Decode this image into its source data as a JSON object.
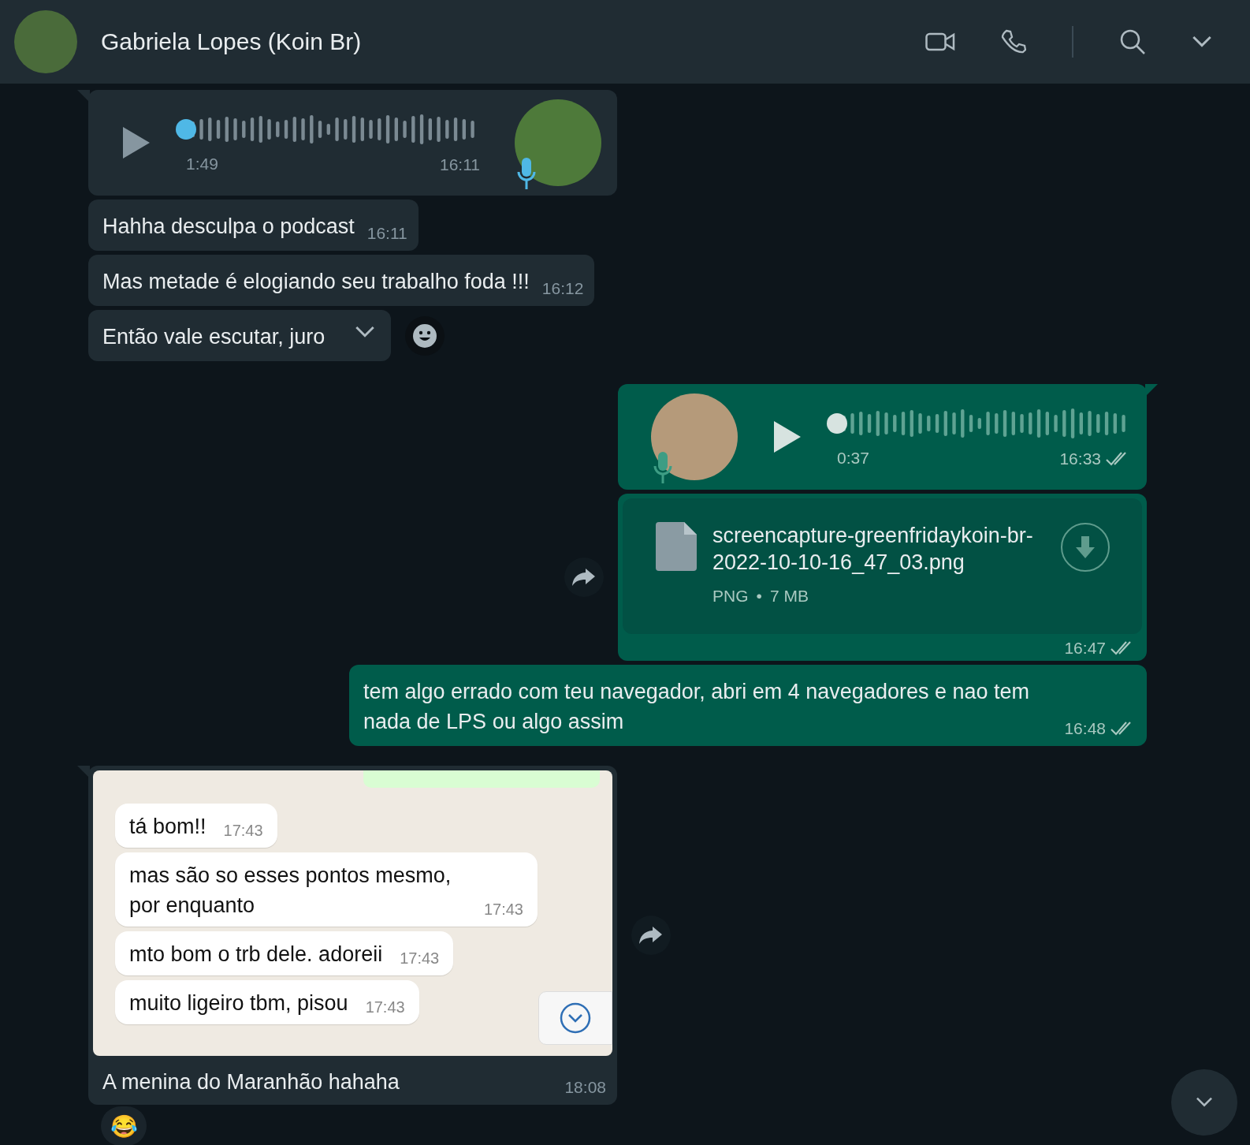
{
  "header": {
    "contact_name": "Gabriela Lopes (Koin Br)"
  },
  "messages": [
    {
      "kind": "voice",
      "outgoing": false,
      "duration": "1:49",
      "time": "16:11"
    },
    {
      "kind": "text",
      "outgoing": false,
      "text": "Hahha desculpa o podcast",
      "time": "16:11"
    },
    {
      "kind": "text",
      "outgoing": false,
      "text": "Mas metade é elogiando seu trabalho foda !!!",
      "time": "16:12"
    },
    {
      "kind": "text",
      "outgoing": false,
      "text": "Então vale escutar, juro",
      "hovered": true
    },
    {
      "kind": "voice",
      "outgoing": true,
      "duration": "0:37",
      "time": "16:33"
    },
    {
      "kind": "file",
      "outgoing": true,
      "file_name": "screencapture-greenfridaykoin-br-2022-10-10-16_47_03.png",
      "file_type": "PNG",
      "separator": "•",
      "file_size": "7 MB",
      "time": "16:47",
      "forward_button": true
    },
    {
      "kind": "text",
      "outgoing": true,
      "text": "tem algo errado com teu navegador, abri em 4 navegadores e nao tem nada de LPS ou algo assim",
      "time": "16:48"
    },
    {
      "kind": "image",
      "outgoing": false,
      "forward_button": true,
      "caption": "A menina do Maranhão hahaha",
      "time": "18:08",
      "reaction": "😂",
      "screenshot": {
        "messages": [
          {
            "text": "tá bom!!",
            "time": "17:43"
          },
          {
            "text": "mas são so esses pontos mesmo, por enquanto",
            "time": "17:43"
          },
          {
            "text": "mto bom o trb dele. adoreii",
            "time": "17:43"
          },
          {
            "text": "muito ligeiro tbm, pisou",
            "time": "17:43"
          }
        ]
      }
    }
  ]
}
